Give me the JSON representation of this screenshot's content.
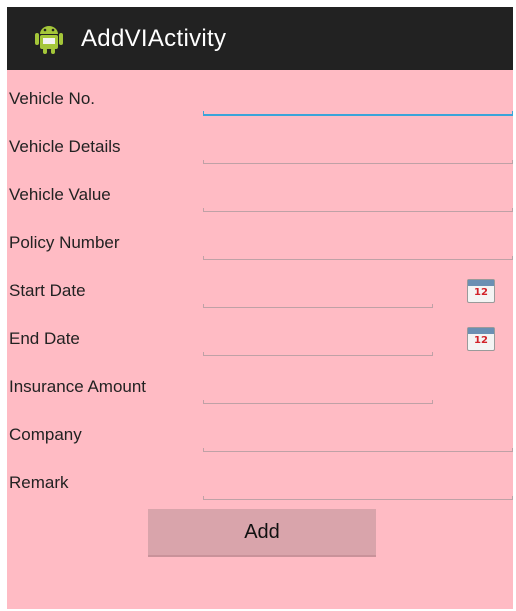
{
  "app": {
    "title": "AddVIActivity",
    "icon": "android-robot-icon"
  },
  "colors": {
    "background": "#ffbbc4",
    "titlebar": "#222222",
    "focus_line": "#3aa4d9",
    "button": "#d9a4ab"
  },
  "form": {
    "fields": [
      {
        "label": "Vehicle No.",
        "value": "",
        "focused": true
      },
      {
        "label": "Vehicle Details",
        "value": ""
      },
      {
        "label": "Vehicle Value",
        "value": ""
      },
      {
        "label": "Policy Number",
        "value": ""
      },
      {
        "label": "Start Date",
        "value": "",
        "has_date_picker": true
      },
      {
        "label": "End Date",
        "value": "",
        "has_date_picker": true
      },
      {
        "label": "Insurance Amount",
        "value": ""
      },
      {
        "label": "Company",
        "value": ""
      },
      {
        "label": "Remark",
        "value": ""
      }
    ],
    "date_picker_icon": {
      "name": "calendar-icon",
      "text": "12"
    },
    "add_label": "Add"
  }
}
